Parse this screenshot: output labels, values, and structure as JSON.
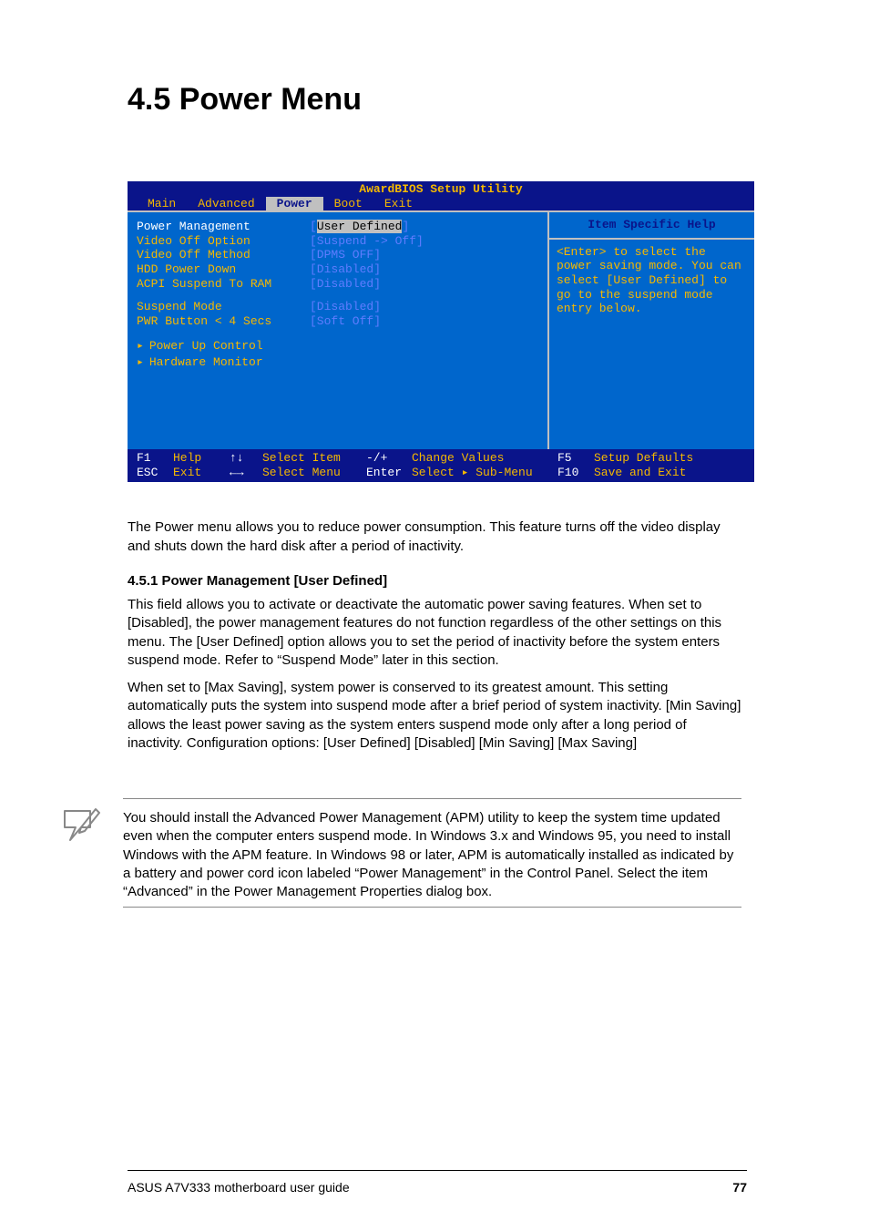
{
  "heading": "4.5    Power Menu",
  "bios": {
    "title": "AwardBIOS Setup Utility",
    "tabs": [
      "Main",
      "Advanced",
      "Power",
      "Boot",
      "Exit"
    ],
    "activeTab": "Power",
    "items": [
      {
        "label": "Power Management",
        "value": "[User Defined]",
        "selected": true
      },
      {
        "label": "Video Off Option",
        "value": "[Suspend -> Off]"
      },
      {
        "label": "Video Off Method",
        "value": "[DPMS OFF]"
      },
      {
        "label": "HDD Power Down",
        "value": "[Disabled]"
      },
      {
        "label": "ACPI Suspend To RAM",
        "value": "[Disabled]"
      }
    ],
    "items2": [
      {
        "label": "Suspend Mode",
        "value": "[Disabled]"
      },
      {
        "label": "PWR Button < 4 Secs",
        "value": "[Soft Off]"
      }
    ],
    "submenus": [
      "Power Up Control",
      "Hardware Monitor"
    ],
    "helpTitle": "Item Specific Help",
    "helpText": "<Enter> to select the power saving mode. You can select [User Defined] to go to the suspend mode entry below.",
    "footer": {
      "r1": {
        "k1": "F1",
        "l1": "Help",
        "a1": "↑↓",
        "t1": "Select Item",
        "m1": "-/+",
        "ml1": "Change Values",
        "k2": "F5",
        "l2": "Setup Defaults"
      },
      "r2": {
        "k1": "ESC",
        "l1": "Exit",
        "a1": "←→",
        "t1": "Select Menu",
        "m1": "Enter",
        "ml1": "Select  ▸ Sub-Menu",
        "k2": "F10",
        "l2": "Save and Exit"
      }
    }
  },
  "intro": "The Power menu allows you to reduce power consumption. This feature turns off the video display and shuts down the hard disk after a period of inactivity.",
  "section1": {
    "title": "4.5.1    Power Management [User Defined]",
    "p1": "This field allows you to activate or deactivate the automatic power saving features. When set to [Disabled], the power management features do not function regardless of the other settings on this menu. The [User Defined] option allows you to set the period of inactivity before the system enters suspend mode. Refer to “Suspend Mode” later in this section.",
    "p2": "When set to [Max Saving], system power is conserved to its greatest amount. This setting automatically puts the system into suspend mode after a brief period of system inactivity. [Min Saving] allows the least power saving as the system enters suspend mode only after a long period of inactivity. Configuration options: [User Defined] [Disabled] [Min Saving] [Max Saving]"
  },
  "note": "You should install the Advanced Power Management (APM) utility to keep the system time updated even when the computer enters suspend mode. In Windows 3.x and Windows 95, you need to install Windows with the APM feature. In Windows 98 or later, APM is automatically installed as indicated by a battery and power cord icon labeled “Power Management” in the Control Panel. Select the item “Advanced” in the Power Management Properties dialog box.",
  "footer": {
    "left": "ASUS A7V333 motherboard user guide",
    "right": "77"
  }
}
